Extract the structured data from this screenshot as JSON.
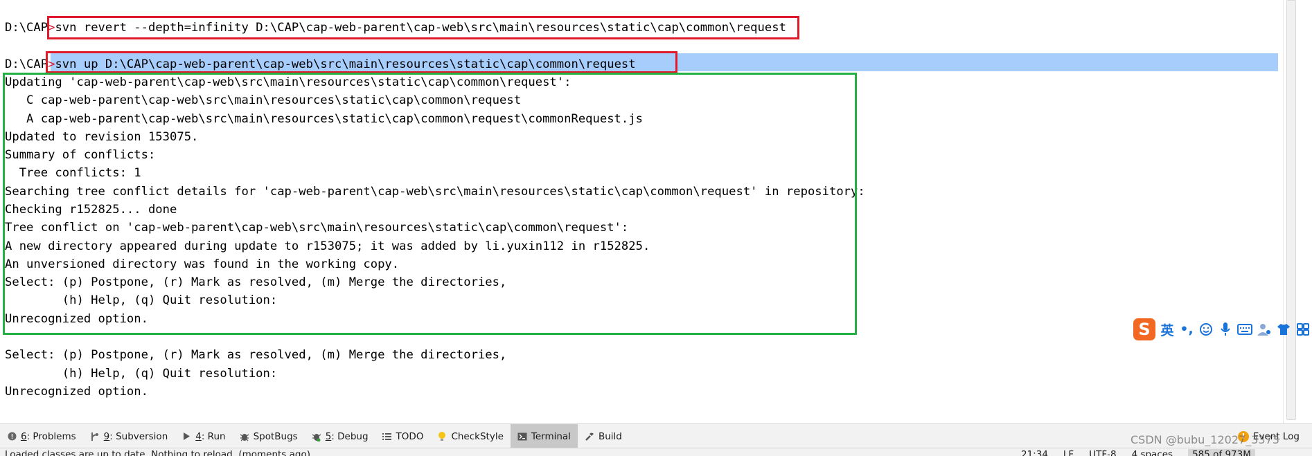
{
  "terminal": {
    "lines": [
      {
        "prompt": "D:\\CAP",
        "caret": ">",
        "text": "svn revert --depth=infinity D:\\CAP\\cap-web-parent\\cap-web\\src\\main\\resources\\static\\cap\\common\\request"
      },
      {
        "prompt": "D:\\CAP",
        "caret": ">",
        "text": "svn up D:\\CAP\\cap-web-parent\\cap-web\\src\\main\\resources\\static\\cap\\common\\request"
      },
      {
        "text": "Updating 'cap-web-parent\\cap-web\\src\\main\\resources\\static\\cap\\common\\request':"
      },
      {
        "text": "   C cap-web-parent\\cap-web\\src\\main\\resources\\static\\cap\\common\\request"
      },
      {
        "text": "   A cap-web-parent\\cap-web\\src\\main\\resources\\static\\cap\\common\\request\\commonRequest.js"
      },
      {
        "text": "Updated to revision 153075."
      },
      {
        "text": "Summary of conflicts:"
      },
      {
        "text": "  Tree conflicts: 1"
      },
      {
        "text": "Searching tree conflict details for 'cap-web-parent\\cap-web\\src\\main\\resources\\static\\cap\\common\\request' in repository:"
      },
      {
        "text": "Checking r152825... done"
      },
      {
        "text": "Tree conflict on 'cap-web-parent\\cap-web\\src\\main\\resources\\static\\cap\\common\\request':"
      },
      {
        "text": "A new directory appeared during update to r153075; it was added by li.yuxin112 in r152825."
      },
      {
        "text": "An unversioned directory was found in the working copy."
      },
      {
        "text": "Select: (p) Postpone, (r) Mark as resolved, (m) Merge the directories,"
      },
      {
        "text": "        (h) Help, (q) Quit resolution:"
      },
      {
        "text": "Unrecognized option."
      },
      {
        "text": "Select: (p) Postpone, (r) Mark as resolved, (m) Merge the directories,"
      },
      {
        "text": "        (h) Help, (q) Quit resolution:"
      },
      {
        "text": "Unrecognized option."
      }
    ],
    "selection_color": "#a6cdfc",
    "annotation_red": "#e0192b",
    "annotation_green": "#25b045"
  },
  "ime": {
    "logo": "S",
    "lang": "英",
    "punct": "•,",
    "icons": [
      "smiley-icon",
      "microphone-icon",
      "keyboard-icon",
      "user-settings-icon",
      "shirt-icon",
      "grid-icon"
    ]
  },
  "tool_windows": [
    {
      "num": "6",
      "label": ": Problems",
      "icon": "problems-icon"
    },
    {
      "num": "9",
      "label": ": Subversion",
      "icon": "subversion-icon"
    },
    {
      "num": "4",
      "label": ": Run",
      "icon": "run-icon"
    },
    {
      "num": "",
      "label": "SpotBugs",
      "icon": "spotbugs-icon"
    },
    {
      "num": "5",
      "label": ": Debug",
      "icon": "debug-icon"
    },
    {
      "num": "",
      "label": "TODO",
      "icon": "todo-icon"
    },
    {
      "num": "",
      "label": "CheckStyle",
      "icon": "checkstyle-icon"
    },
    {
      "num": "",
      "label": "Terminal",
      "icon": "terminal-icon",
      "active": true
    },
    {
      "num": "",
      "label": "Build",
      "icon": "build-icon"
    }
  ],
  "event_log": {
    "label": "Event Log"
  },
  "watermark": "CSDN @bubu_12027_3373",
  "statusbar": {
    "message": "Loaded classes are up to date. Nothing to reload. (moments ago)",
    "position": "21:34",
    "line_sep": "LF",
    "encoding": "UTF-8",
    "indent": "4 spaces",
    "memory": "585 of 973M"
  }
}
